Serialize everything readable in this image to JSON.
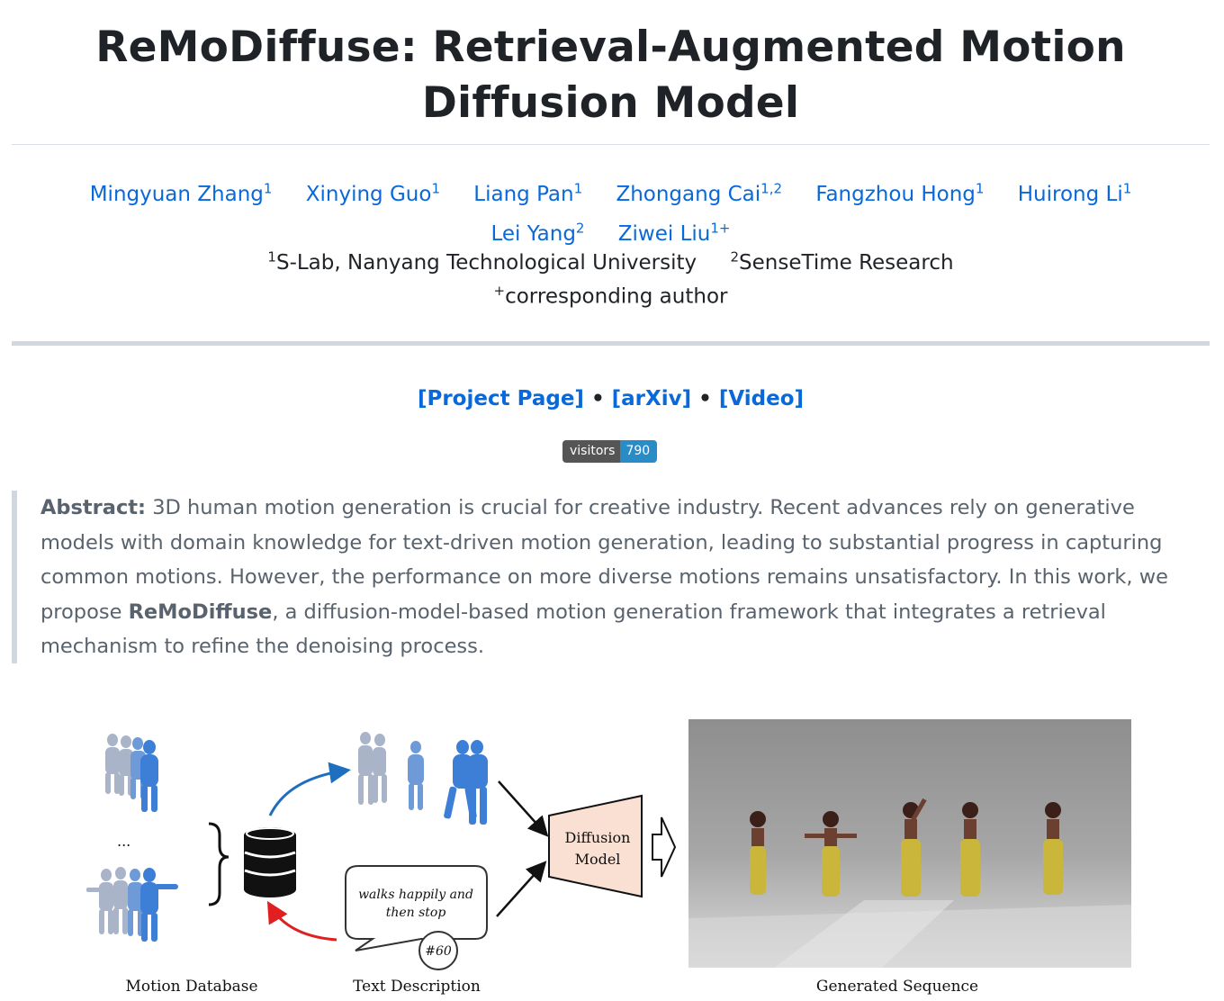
{
  "title": "ReMoDiffuse: Retrieval-Augmented Motion Diffusion Model",
  "authors": [
    {
      "name": "Mingyuan Zhang",
      "sup": "1"
    },
    {
      "name": "Xinying Guo",
      "sup": "1"
    },
    {
      "name": "Liang Pan",
      "sup": "1"
    },
    {
      "name": "Zhongang Cai",
      "sup": "1,2"
    },
    {
      "name": "Fangzhou Hong",
      "sup": "1"
    },
    {
      "name": "Huirong Li",
      "sup": "1"
    },
    {
      "name": "Lei Yang",
      "sup": "2"
    },
    {
      "name": "Ziwei Liu",
      "sup": "1+"
    }
  ],
  "affiliations": [
    {
      "sup": "1",
      "name": "S-Lab, Nanyang Technological University"
    },
    {
      "sup": "2",
      "name": "SenseTime Research"
    }
  ],
  "corresponding": {
    "sup": "+",
    "text": "corresponding author"
  },
  "links": [
    {
      "label": "[Project Page]"
    },
    {
      "label": "[arXiv]"
    },
    {
      "label": "[Video]"
    }
  ],
  "link_separator": "•",
  "badge": {
    "label": "visitors",
    "count": "790"
  },
  "abstract": {
    "lead": "Abstract:",
    "part1": " 3D human motion generation is crucial for creative industry. Recent advances rely on generative models with domain knowledge for text-driven motion generation, leading to substantial progress in capturing common motions. However, the performance on more diverse motions remains unsatisfactory. In this work, we propose ",
    "highlight": "ReMoDiffuse",
    "part2": ", a diffusion-model-based motion generation framework that integrates a retrieval mechanism to refine the denoising process."
  },
  "figure": {
    "ellipsis": "...",
    "text_bubble_line1": "walks happily and",
    "text_bubble_line2": "then stop",
    "step_label": "#60",
    "diffusion_line1": "Diffusion",
    "diffusion_line2": "Model",
    "label_database": "Motion Database",
    "label_text": "Text Description",
    "label_generated": "Generated Sequence",
    "colors": {
      "motion_blue": "#3d7fd6",
      "motion_grey": "#aab4c8",
      "retrieve_arrow": "#1f6fbf",
      "query_arrow": "#e02020",
      "diffusion_fill": "#f9e0d2",
      "render_bg": "#9c9c9c"
    }
  }
}
